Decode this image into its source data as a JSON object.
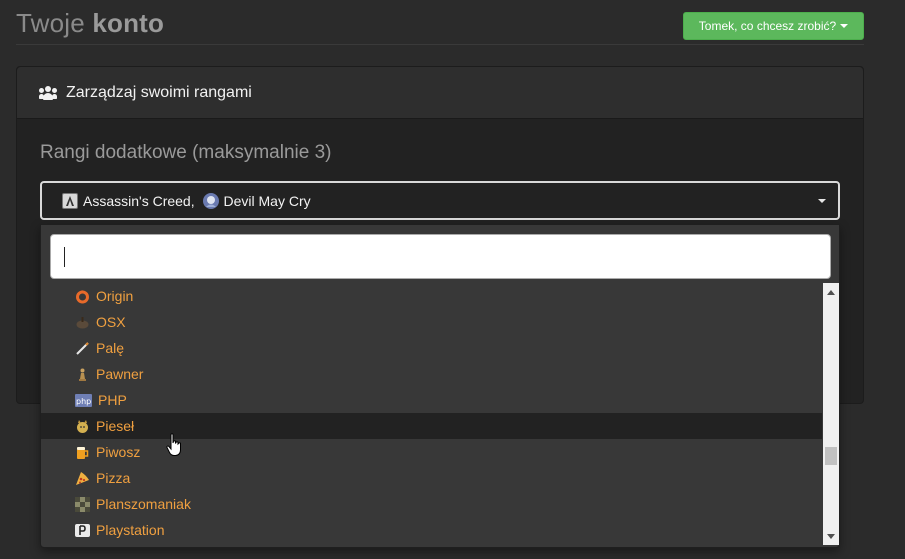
{
  "header": {
    "title_light": "Twoje",
    "title_bold": "konto",
    "user_menu_label": "Tomek, co chcesz zrobić?"
  },
  "panel": {
    "heading": "Zarządzaj swoimi rangami",
    "heading_icon": "users-icon"
  },
  "ranks": {
    "label": "Rangi dodatkowe (maksymalnie 3)",
    "selected": [
      {
        "label": "Assassin's Creed",
        "icon": "assassins-creed-icon",
        "separator": ", "
      },
      {
        "label": "Devil May Cry",
        "icon": "devil-may-cry-icon",
        "separator": ""
      }
    ],
    "search_value": "",
    "options": [
      {
        "label": "Origin",
        "icon": "origin-icon",
        "color": "#e86a2a"
      },
      {
        "label": "OSX",
        "icon": "osx-icon",
        "color": "#5a4a3a"
      },
      {
        "label": "Palę",
        "icon": "cigarette-icon",
        "color": "#d9d9d9"
      },
      {
        "label": "Pawner",
        "icon": "pawn-icon",
        "color": "#c8a060"
      },
      {
        "label": "PHP",
        "icon": "php-icon",
        "color": "#6f7fb5"
      },
      {
        "label": "Pieseł",
        "icon": "doge-icon",
        "color": "#d4b050"
      },
      {
        "label": "Piwosz",
        "icon": "beer-icon",
        "color": "#f0a020"
      },
      {
        "label": "Pizza",
        "icon": "pizza-icon",
        "color": "#e07a30"
      },
      {
        "label": "Planszomaniak",
        "icon": "board-game-icon",
        "color": "#8a8a6a"
      },
      {
        "label": "Playstation",
        "icon": "playstation-icon",
        "color": "#e6e6e6"
      }
    ],
    "hovered_option": "Pieseł"
  },
  "colors": {
    "accent_green": "#5cb85c",
    "option_text": "#f0a040",
    "background": "#2b2b2b"
  }
}
